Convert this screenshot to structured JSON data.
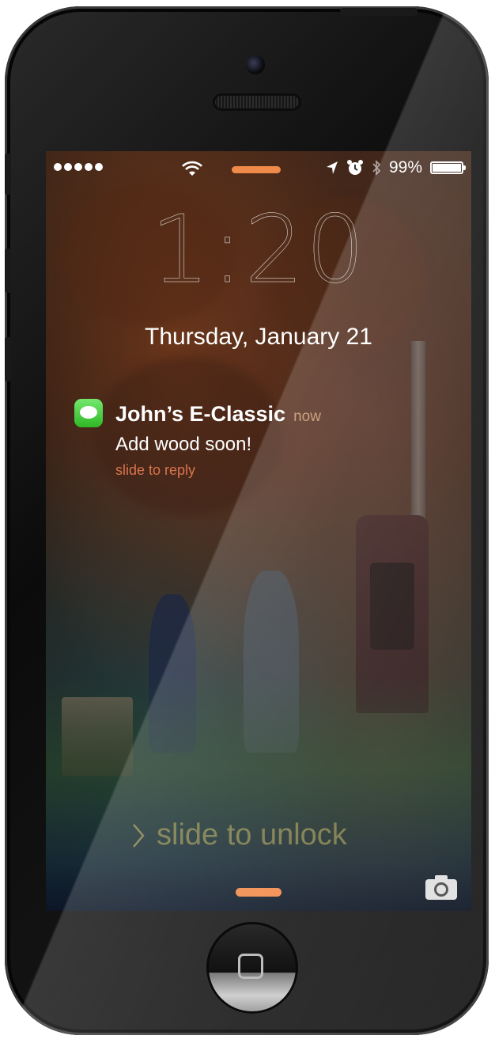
{
  "status_bar": {
    "signal_icon": "signal-dots-icon",
    "wifi_icon": "wifi-icon",
    "location_icon": "location-arrow-icon",
    "alarm_icon": "alarm-clock-icon",
    "bluetooth_icon": "bluetooth-icon",
    "battery_percent": "99%",
    "battery_level": 0.99
  },
  "lock_screen": {
    "time": "1:20",
    "date": "Thursday, January 21",
    "slide_to_unlock": "slide to unlock",
    "camera_icon": "camera-icon"
  },
  "notification": {
    "app_icon": "messages-icon",
    "sender": "John’s E-Classic",
    "time": "now",
    "message": "Add wood soon!",
    "action": "slide to reply"
  },
  "colors": {
    "accent_orange": "#f08a4a",
    "messages_green": "#3fc93a",
    "reply_hint": "#e27850"
  }
}
